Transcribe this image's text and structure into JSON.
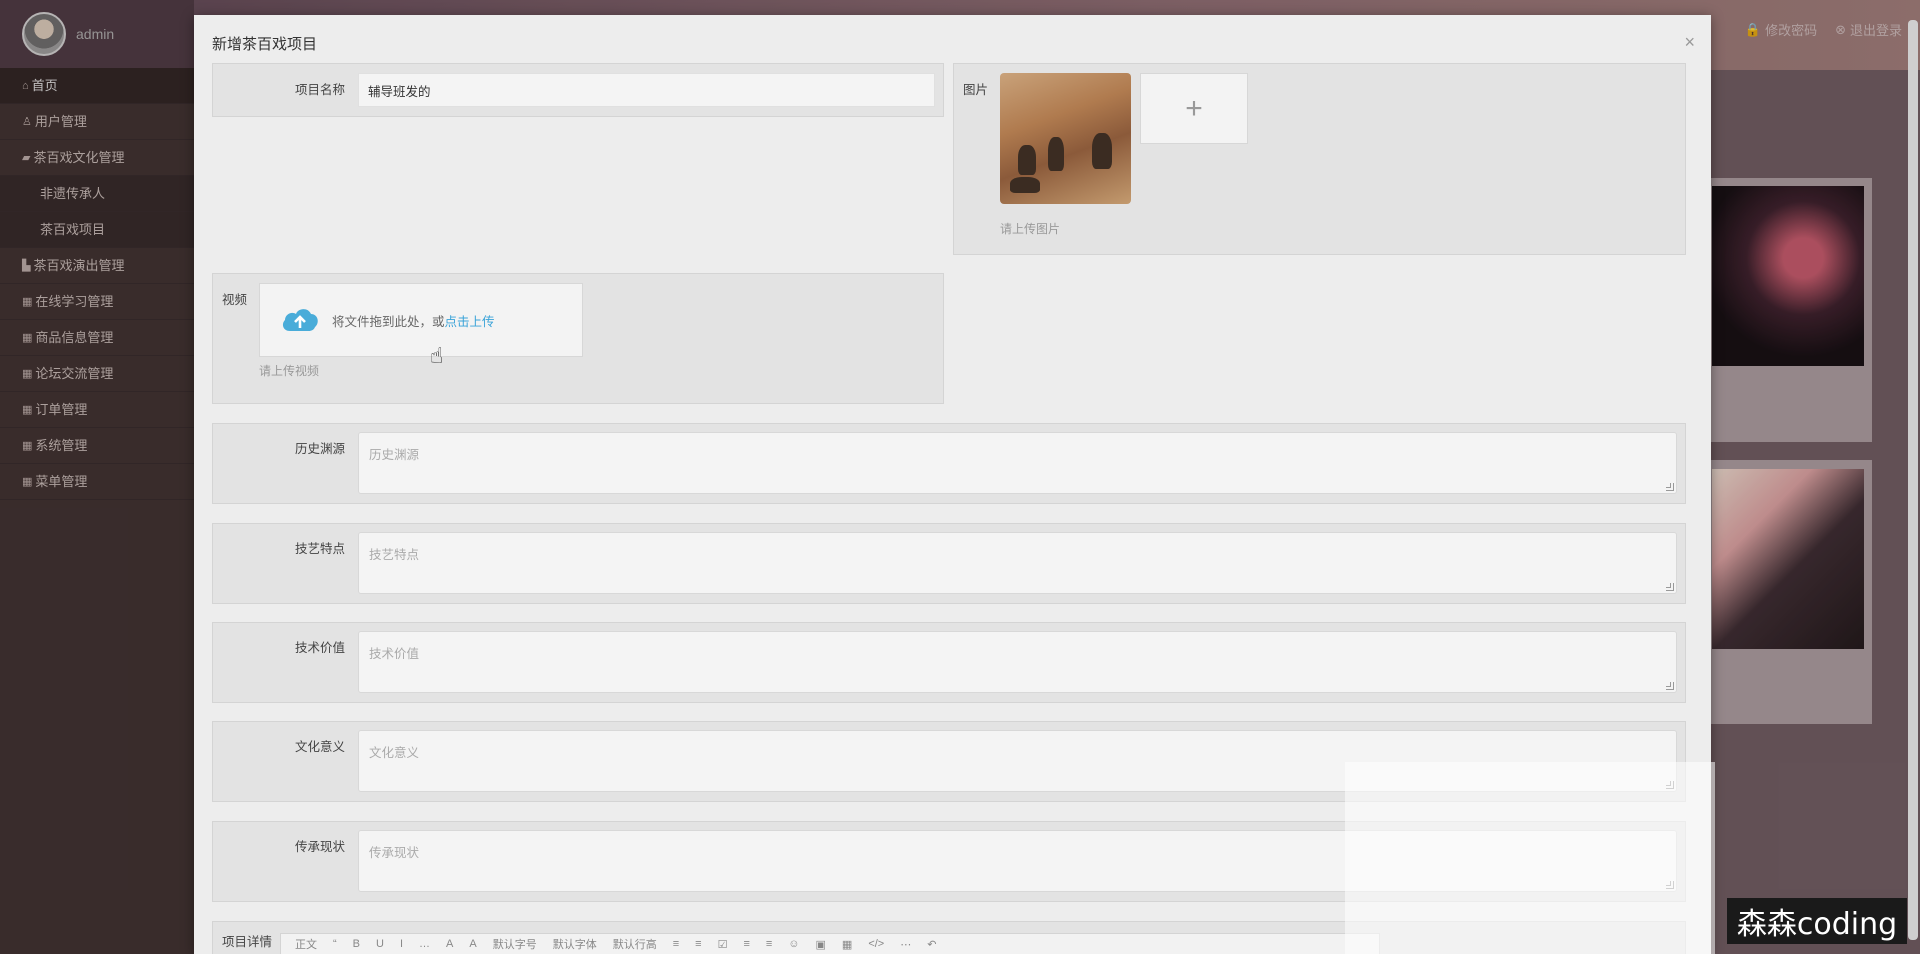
{
  "header": {
    "change_password": "修改密码",
    "logout": "退出登录"
  },
  "sidebar": {
    "username": "admin",
    "items": [
      {
        "label": "首页",
        "icon": "home-icon"
      },
      {
        "label": "用户管理",
        "icon": "user-icon"
      },
      {
        "label": "茶百戏文化管理",
        "icon": "folder-icon"
      },
      {
        "label": "非遗传承人",
        "icon": ""
      },
      {
        "label": "茶百戏项目",
        "icon": ""
      },
      {
        "label": "茶百戏演出管理",
        "icon": "chart-icon"
      },
      {
        "label": "在线学习管理",
        "icon": "grid-icon"
      },
      {
        "label": "商品信息管理",
        "icon": "grid-icon"
      },
      {
        "label": "论坛交流管理",
        "icon": "grid-icon"
      },
      {
        "label": "订单管理",
        "icon": "grid-icon"
      },
      {
        "label": "系统管理",
        "icon": "grid-icon"
      },
      {
        "label": "菜单管理",
        "icon": "grid-icon"
      }
    ]
  },
  "modal": {
    "title": "新增茶百戏项目",
    "close": "×",
    "name_label": "项目名称",
    "name_value": "辅导班发的",
    "image_label": "图片",
    "image_add": "+",
    "image_hint": "请上传图片",
    "video_label": "视频",
    "video_drop_text": "将文件拖到此处，或",
    "video_drop_link": "点击上传",
    "video_hint": "请上传视频",
    "fields": [
      {
        "label": "历史渊源",
        "placeholder": "历史渊源"
      },
      {
        "label": "技艺特点",
        "placeholder": "技艺特点"
      },
      {
        "label": "技术价值",
        "placeholder": "技术价值"
      },
      {
        "label": "文化意义",
        "placeholder": "文化意义"
      },
      {
        "label": "传承现状",
        "placeholder": "传承现状"
      }
    ],
    "detail_label": "项目详情",
    "toolbar": [
      "正文",
      "“",
      "B",
      "U",
      "I",
      "…",
      "A",
      "A",
      "默认字号",
      "默认字体",
      "默认行高",
      "≡",
      "≡",
      "☑",
      "≡",
      "≡",
      "☺",
      "▣",
      "▦",
      "</>",
      "⋯",
      "↶"
    ]
  },
  "watermark": "森森coding"
}
